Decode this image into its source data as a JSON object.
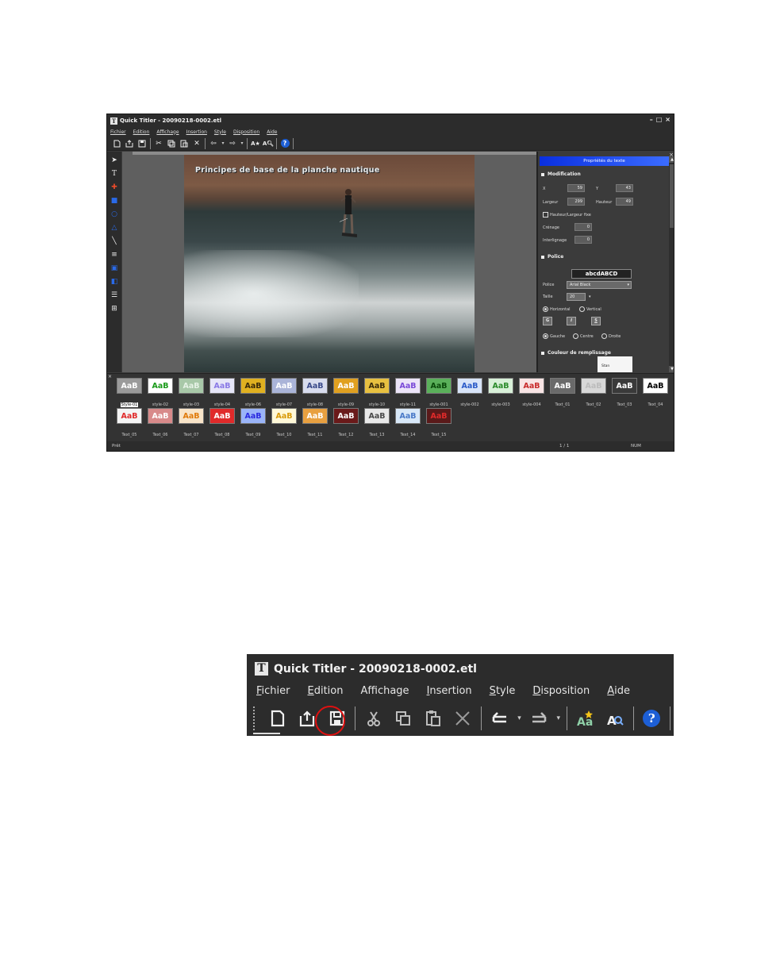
{
  "app": {
    "title": "Quick Titler - 20090218-0002.etl",
    "logo_letter": "T",
    "window_controls": [
      "–",
      "□",
      "×"
    ],
    "menu": [
      "Fichier",
      "Edition",
      "Affichage",
      "Insertion",
      "Style",
      "Disposition",
      "Aide"
    ]
  },
  "canvas": {
    "video_title": "Principes de base de la planche nautique"
  },
  "properties": {
    "header": "Propriétés du texte",
    "close": "×",
    "section_modification": "Modification",
    "x_label": "X",
    "x_value": "59",
    "y_label": "Y",
    "y_value": "43",
    "width_label": "Largeur",
    "width_value": "299",
    "height_label": "Hauteur",
    "height_value": "49",
    "fixed_hw_label": "Hauteur/Largeur fixe",
    "kerning_label": "Crénage",
    "kerning_value": "0",
    "linespacing_label": "Interlignage",
    "linespacing_value": "0",
    "section_police": "Police",
    "font_sample": "abcdABCD",
    "font_label": "Police",
    "font_value": "Arial Black",
    "size_label": "Taille",
    "size_value": "20",
    "orientation_horizontal": "Horizontal",
    "orientation_vertical": "Vertical",
    "bold": "G",
    "italic": "I",
    "underline": "S",
    "align_left": "Gauche",
    "align_center": "Centre",
    "align_right": "Droite",
    "section_fill": "Couleur de remplissage",
    "fill_text": "Stan"
  },
  "gallery": {
    "close": "×",
    "styles": [
      {
        "label": "Style-01",
        "text": "AaB",
        "fg": "#ffffff",
        "bg": "#9a9a9a",
        "selected": true
      },
      {
        "label": "style-02",
        "text": "AaB",
        "fg": "#1a9a1a",
        "bg": "#ffffff"
      },
      {
        "label": "style-03",
        "text": "AaB",
        "fg": "#e6f2e6",
        "bg": "#a8c8a8"
      },
      {
        "label": "style-04",
        "text": "AaB",
        "fg": "#8a7ae6",
        "bg": "#e6e6f8"
      },
      {
        "label": "style-06",
        "text": "AaB",
        "fg": "#3a2a0a",
        "bg": "#e0b020"
      },
      {
        "label": "style-07",
        "text": "AaB",
        "fg": "#ffffff",
        "bg": "#aab4d8"
      },
      {
        "label": "style-08",
        "text": "AaB",
        "fg": "#3a4a8a",
        "bg": "#d8dcee"
      },
      {
        "label": "style-09",
        "text": "AaB",
        "fg": "#ffffff",
        "bg": "#e0a020"
      },
      {
        "label": "style-10",
        "text": "AaB",
        "fg": "#3a2a0a",
        "bg": "#e8c040"
      },
      {
        "label": "style-11",
        "text": "AaB",
        "fg": "#7a4ad8",
        "bg": "#ece4f8"
      },
      {
        "label": "style-001",
        "text": "AaB",
        "fg": "#0a4a0a",
        "bg": "#5ab05a"
      },
      {
        "label": "style-002",
        "text": "AaB",
        "fg": "#2a5ac8",
        "bg": "#d8e4f8"
      },
      {
        "label": "style-003",
        "text": "AaB",
        "fg": "#2a8a2a",
        "bg": "#d8f0d8"
      },
      {
        "label": "style-004",
        "text": "AaB",
        "fg": "#c82a2a",
        "bg": "#f8e4e4"
      },
      {
        "label": "Text_01",
        "text": "AaB",
        "fg": "#ffffff",
        "bg": "#6a6a6a"
      },
      {
        "label": "Text_02",
        "text": "AaB",
        "fg": "#bcbcbc",
        "bg": "#d8d8d8"
      },
      {
        "label": "Text_03",
        "text": "AaB",
        "fg": "#ffffff",
        "bg": "#3a3a3a"
      },
      {
        "label": "Text_04",
        "text": "AaB",
        "fg": "#000000",
        "bg": "#ffffff"
      },
      {
        "label": "Text_05",
        "text": "AaB",
        "fg": "#e02a2a",
        "bg": "#f4f4f4"
      },
      {
        "label": "Text_06",
        "text": "AaB",
        "fg": "#ffffff",
        "bg": "#d88a8a"
      },
      {
        "label": "Text_07",
        "text": "AaB",
        "fg": "#e07a0a",
        "bg": "#f8e4c8"
      },
      {
        "label": "Text_08",
        "text": "AaB",
        "fg": "#ffffff",
        "bg": "#e02a2a"
      },
      {
        "label": "Text_09",
        "text": "AaB",
        "fg": "#2a2ae0",
        "bg": "#9ab4f8"
      },
      {
        "label": "Text_10",
        "text": "AaB",
        "fg": "#d89a0a",
        "bg": "#fff8d8"
      },
      {
        "label": "Text_11",
        "text": "AaB",
        "fg": "#ffffff",
        "bg": "#e8a040"
      },
      {
        "label": "Text_12",
        "text": "AaB",
        "fg": "#ffffff",
        "bg": "#6a1a1a"
      },
      {
        "label": "Text_13",
        "text": "AaB",
        "fg": "#4a4a4a",
        "bg": "#e8e8e8"
      },
      {
        "label": "Text_14",
        "text": "AaB",
        "fg": "#4a7ac8",
        "bg": "#d8e8f8"
      },
      {
        "label": "Text_15",
        "text": "AaB",
        "fg": "#e02a2a",
        "bg": "#5a1a1a"
      }
    ]
  },
  "status": {
    "left": "Prêt",
    "page": "1 / 1",
    "num": "NUM"
  },
  "zoom": {
    "title": "Quick Titler - 20090218-0002.etl",
    "logo_letter": "T",
    "menu": [
      {
        "u": "F",
        "rest": "ichier"
      },
      {
        "u": "E",
        "rest": "dition"
      },
      {
        "u": "",
        "rest": "Affichage"
      },
      {
        "u": "I",
        "rest": "nsertion"
      },
      {
        "u": "S",
        "rest": "tyle"
      },
      {
        "u": "D",
        "rest": "isposition"
      },
      {
        "u": "A",
        "rest": "ide"
      }
    ],
    "help_glyph": "?"
  },
  "colors": {
    "highlight": "#e01010",
    "title_bar": "#2c2c2c",
    "panel_header": "#1e46f0"
  }
}
